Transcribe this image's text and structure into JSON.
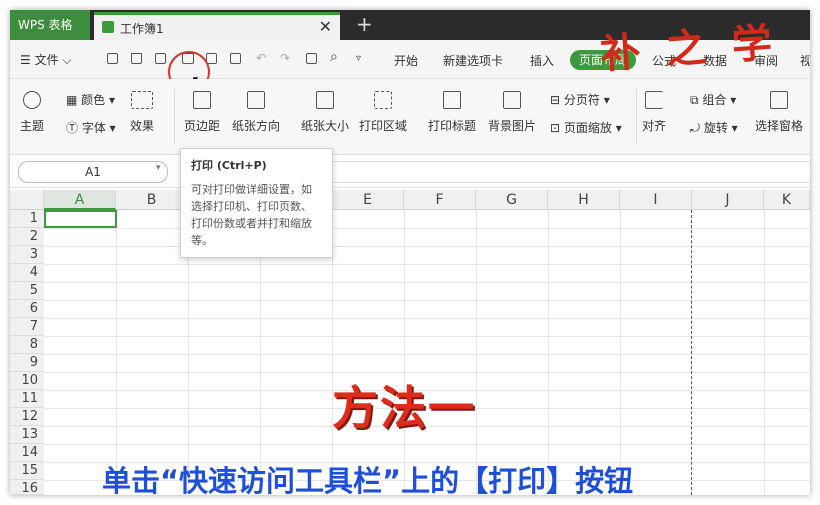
{
  "window": {
    "app_tab": "WPS 表格",
    "doc_tab": "工作簿1",
    "close_glyph": "✕",
    "new_tab_glyph": "+"
  },
  "menubar": {
    "file_label": "文件",
    "items": [
      "开始",
      "新建选项卡",
      "插入",
      "页面布局",
      "公式",
      "数据",
      "审阅",
      "视"
    ],
    "active_item": "页面布局"
  },
  "ribbon": {
    "theme": "主题",
    "color": "颜色",
    "font": "字体",
    "effect": "效果",
    "margins": "页边距",
    "orientation": "纸张方向",
    "size": "纸张大小",
    "print_area": "打印区域",
    "print_titles": "打印标题",
    "background": "背景图片",
    "page_break": "分页符",
    "page_scale": "页面缩放",
    "group": "组合",
    "align": "对齐",
    "rotate": "旋转",
    "selection_pane": "选择窗格"
  },
  "formulabar": {
    "name_box": "A1"
  },
  "grid": {
    "columns": [
      "A",
      "B",
      "C",
      "D",
      "E",
      "F",
      "G",
      "H",
      "I",
      "J",
      "K"
    ],
    "rows": [
      "1",
      "2",
      "3",
      "4",
      "5",
      "6",
      "7",
      "8",
      "9",
      "10",
      "11",
      "12",
      "13",
      "14",
      "15",
      "16"
    ],
    "selected_cell": "A1"
  },
  "tooltip": {
    "title": "打印 (Ctrl+P)",
    "description": "可对打印做详细设置，如选择打印机、打印页数、打印份数或者并打和缩放等。"
  },
  "overlay": {
    "brand": "补 之 学",
    "method": "方法一",
    "caption": "单击“快速访问工具栏”上的【打印】按钮"
  },
  "colors": {
    "accent_green": "#3c9a3c",
    "highlight_red": "#d8342a",
    "caption_blue": "#1e4fd8"
  }
}
